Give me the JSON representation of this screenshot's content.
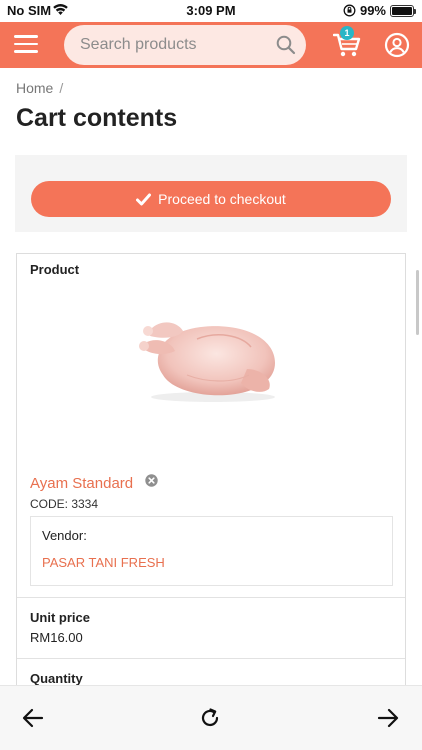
{
  "status_bar": {
    "carrier": "No SIM",
    "time": "3:09 PM",
    "battery": "99%",
    "battery_level": 0.99
  },
  "header": {
    "search_placeholder": "Search products",
    "cart_count": "1",
    "brand_color": "#f47458"
  },
  "breadcrumb": {
    "home": "Home",
    "separator": "/"
  },
  "page_title": "Cart contents",
  "checkout": {
    "button_label": "Proceed to checkout"
  },
  "table": {
    "product_header": "Product",
    "unit_price_header": "Unit price",
    "quantity_header": "Quantity"
  },
  "item": {
    "name": "Ayam Standard",
    "code": "CODE: 3334",
    "vendor_label": "Vendor:",
    "vendor_name": "PASAR TANI FRESH",
    "unit_price": "RM16.00"
  },
  "icons": {
    "menu": "menu-icon",
    "search": "search-icon",
    "cart": "cart-icon",
    "account": "account-icon",
    "checkout": "checkmark-icon",
    "remove": "remove-icon",
    "back": "back-arrow-icon",
    "reload": "reload-icon",
    "forward": "forward-arrow-icon"
  }
}
